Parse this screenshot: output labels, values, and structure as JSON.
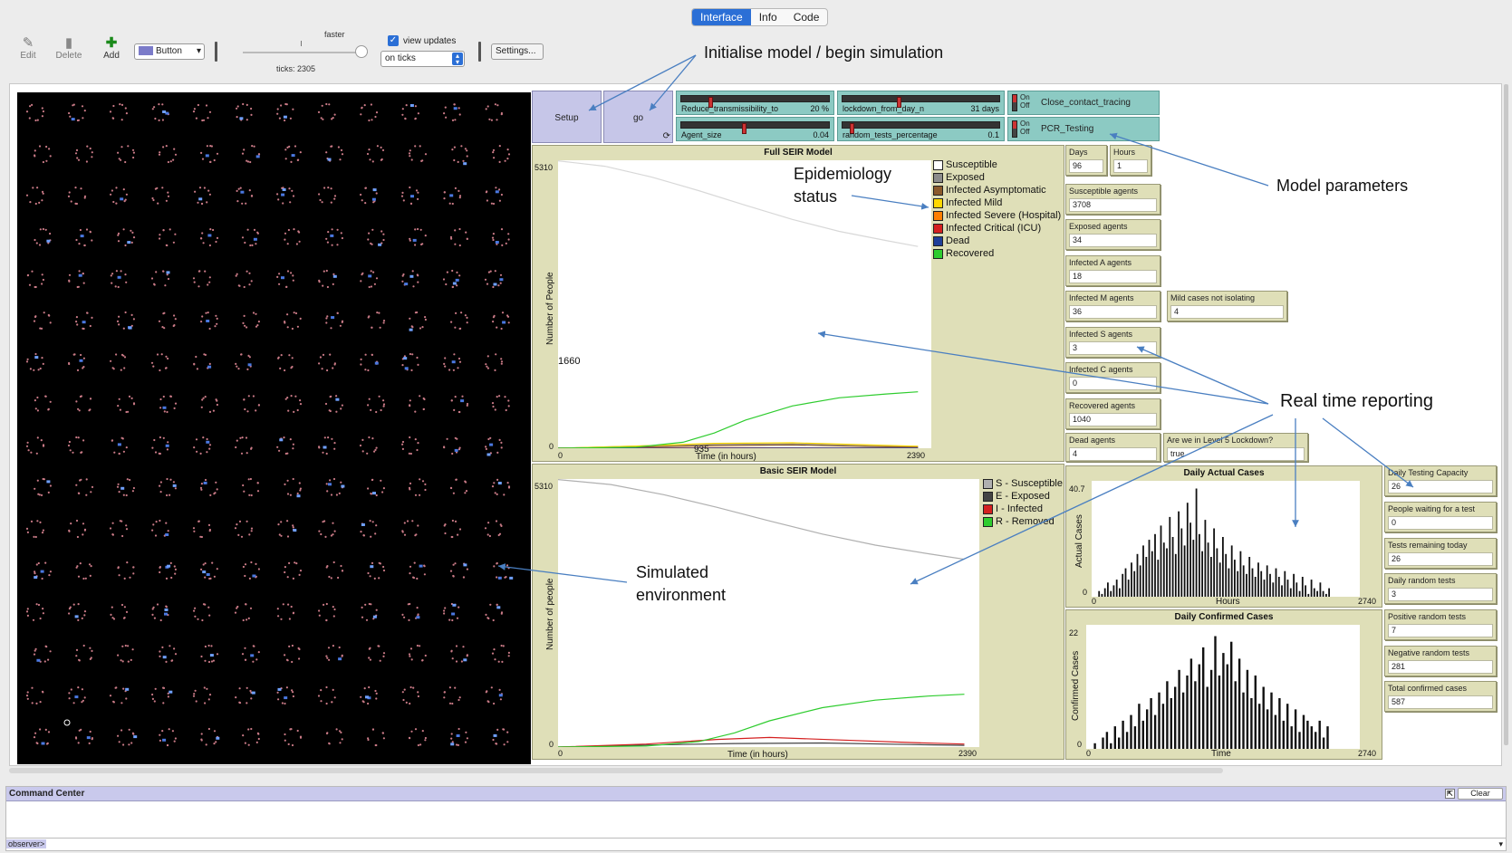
{
  "tabs": [
    {
      "label": "Interface",
      "active": true
    },
    {
      "label": "Info",
      "active": false
    },
    {
      "label": "Code",
      "active": false
    }
  ],
  "toolbar": {
    "edit_label": "Edit",
    "delete_label": "Delete",
    "add_label": "Add",
    "widget_type": "Button",
    "speed_label": "faster",
    "ticks_label": "ticks: 2305",
    "view_updates_label": "view updates",
    "view_updates_checked": true,
    "update_mode": "on ticks",
    "settings_label": "Settings..."
  },
  "buttons": {
    "setup": "Setup",
    "go": "go"
  },
  "sliders": [
    {
      "label": "Reduce_transmissibility_to",
      "value": "20 %",
      "level": 0.18
    },
    {
      "label": "lockdown_from_day_n",
      "value": "31 days",
      "level": 0.35
    },
    {
      "label": "Agent_size",
      "value": "0.04",
      "level": 0.4
    },
    {
      "label": "random_tests_percentage",
      "value": "0.1",
      "level": 0.05
    }
  ],
  "switches": [
    {
      "on": "On",
      "off": "Off",
      "label": "Close_contact_tracing"
    },
    {
      "on": "On",
      "off": "Off",
      "label": "PCR_Testing"
    }
  ],
  "monitors": {
    "days": {
      "label": "Days",
      "value": "96"
    },
    "hours": {
      "label": "Hours",
      "value": "1"
    },
    "susceptible": {
      "label": "Susceptible agents",
      "value": "3708"
    },
    "exposed": {
      "label": "Exposed agents",
      "value": "34"
    },
    "infected_a": {
      "label": "Infected A agents",
      "value": "18"
    },
    "infected_m": {
      "label": "Infected M agents",
      "value": "36"
    },
    "mild_not_isolating": {
      "label": "Mild cases not isolating",
      "value": "4"
    },
    "infected_s": {
      "label": "Infected S agents",
      "value": "3"
    },
    "infected_c": {
      "label": "Infected C agents",
      "value": "0"
    },
    "recovered": {
      "label": "Recovered agents",
      "value": "1040"
    },
    "dead": {
      "label": "Dead agents",
      "value": "4"
    },
    "lockdown": {
      "label": "Are we in Level 5 Lockdown?",
      "value": "true"
    },
    "daily_testing": {
      "label": "Daily Testing Capacity",
      "value": "26"
    },
    "waiting": {
      "label": "People waiting for a test",
      "value": "0"
    },
    "tests_remaining": {
      "label": "Tests remaining today",
      "value": "26"
    },
    "daily_random": {
      "label": "Daily random tests",
      "value": "3"
    },
    "positive_random": {
      "label": "Positive random tests",
      "value": "7"
    },
    "negative_random": {
      "label": "Negative random tests",
      "value": "281"
    },
    "total_confirmed": {
      "label": "Total confirmed cases",
      "value": "587"
    }
  },
  "chart_data": [
    {
      "type": "line",
      "title": "Full SEIR Model",
      "xlabel": "Time (in hours)",
      "ylabel": "Number of People",
      "xlim": [
        0,
        2390
      ],
      "ylim": [
        0,
        5310
      ],
      "x_ticks": [
        "0",
        "2390"
      ],
      "y_ticks": [
        "0",
        "5310"
      ],
      "annotations": [
        "1660",
        "935"
      ],
      "series": [
        {
          "name": "Susceptible",
          "color": "#ffffff",
          "x": [
            0,
            300,
            600,
            900,
            1200,
            1500,
            1800,
            2100,
            2305
          ],
          "y": [
            5300,
            5200,
            5000,
            4750,
            4480,
            4220,
            4000,
            3830,
            3720
          ]
        },
        {
          "name": "Exposed",
          "color": "#8c8c8c",
          "x": [
            0,
            500,
            1000,
            1500,
            2000,
            2305
          ],
          "y": [
            0,
            40,
            70,
            80,
            50,
            34
          ]
        },
        {
          "name": "Infected Asymptomatic",
          "color": "#8b5a2b",
          "x": [
            0,
            500,
            1000,
            1500,
            2000,
            2305
          ],
          "y": [
            0,
            20,
            50,
            60,
            30,
            18
          ]
        },
        {
          "name": "Infected Mild",
          "color": "#ffd800",
          "x": [
            0,
            500,
            1000,
            1500,
            2000,
            2305
          ],
          "y": [
            0,
            40,
            90,
            100,
            60,
            36
          ]
        },
        {
          "name": "Infected Severe (Hospital)",
          "color": "#ff7f00",
          "x": [
            0,
            1000,
            2305
          ],
          "y": [
            0,
            10,
            3
          ]
        },
        {
          "name": "Infected Critical (ICU)",
          "color": "#d42020",
          "x": [
            0,
            1000,
            2305
          ],
          "y": [
            0,
            4,
            0
          ]
        },
        {
          "name": "Dead",
          "color": "#1f3f99",
          "x": [
            0,
            1000,
            2305
          ],
          "y": [
            0,
            2,
            4
          ]
        },
        {
          "name": "Recovered",
          "color": "#2ecc2e",
          "x": [
            0,
            500,
            800,
            1000,
            1200,
            1500,
            1800,
            2100,
            2305
          ],
          "y": [
            0,
            20,
            110,
            280,
            520,
            780,
            930,
            1000,
            1040
          ]
        }
      ],
      "legend": "right"
    },
    {
      "type": "line",
      "title": "Basic SEIR Model",
      "xlabel": "Time (in hours)",
      "ylabel": "Number of people",
      "xlim": [
        0,
        2390
      ],
      "ylim": [
        0,
        5310
      ],
      "x_ticks": [
        "0",
        "2390"
      ],
      "y_ticks": [
        "0",
        "5310"
      ],
      "series": [
        {
          "name": "S - Susceptible",
          "color": "#b0b0b0",
          "x": [
            0,
            300,
            600,
            900,
            1200,
            1500,
            1800,
            2100,
            2305
          ],
          "y": [
            5300,
            5200,
            5000,
            4750,
            4480,
            4220,
            4000,
            3830,
            3720
          ]
        },
        {
          "name": "E - Exposed",
          "color": "#444444",
          "x": [
            0,
            500,
            1000,
            1500,
            2000,
            2305
          ],
          "y": [
            0,
            40,
            70,
            80,
            50,
            34
          ]
        },
        {
          "name": "I - Infected",
          "color": "#d42020",
          "x": [
            0,
            500,
            900,
            1200,
            1600,
            2000,
            2305
          ],
          "y": [
            0,
            60,
            150,
            190,
            140,
            90,
            60
          ]
        },
        {
          "name": "R - Removed",
          "color": "#2ecc2e",
          "x": [
            0,
            500,
            800,
            1000,
            1200,
            1500,
            1800,
            2100,
            2305
          ],
          "y": [
            0,
            20,
            110,
            280,
            520,
            780,
            930,
            1010,
            1045
          ]
        }
      ],
      "legend": "right"
    },
    {
      "type": "bar",
      "title": "Daily Actual Cases",
      "xlabel": "Hours",
      "ylabel": "Actual Cases",
      "xlim": [
        0,
        2740
      ],
      "ylim": [
        0,
        40.7
      ],
      "x_ticks": [
        "0",
        "2740"
      ],
      "y_ticks": [
        "0",
        "40.7"
      ],
      "values": [
        0,
        2,
        1,
        3,
        5,
        2,
        4,
        6,
        3,
        8,
        10,
        6,
        12,
        9,
        15,
        11,
        18,
        14,
        20,
        16,
        22,
        13,
        25,
        19,
        17,
        28,
        21,
        15,
        30,
        24,
        18,
        33,
        26,
        20,
        38,
        22,
        16,
        27,
        19,
        14,
        24,
        17,
        12,
        21,
        15,
        10,
        18,
        13,
        9,
        16,
        11,
        8,
        14,
        10,
        7,
        12,
        9,
        6,
        11,
        8,
        5,
        10,
        7,
        4,
        9,
        6,
        3,
        8,
        5,
        2,
        7,
        4,
        1,
        6,
        3,
        2,
        5,
        2,
        1,
        3
      ]
    },
    {
      "type": "bar",
      "title": "Daily Confirmed Cases",
      "xlabel": "Time",
      "ylabel": "Confirmed Cases",
      "xlim": [
        0,
        2740
      ],
      "ylim": [
        0,
        22
      ],
      "x_ticks": [
        "0",
        "2740"
      ],
      "y_ticks": [
        "0",
        "22"
      ],
      "values": [
        0,
        1,
        0,
        2,
        3,
        1,
        4,
        2,
        5,
        3,
        6,
        4,
        8,
        5,
        7,
        9,
        6,
        10,
        8,
        12,
        9,
        11,
        14,
        10,
        13,
        16,
        12,
        15,
        18,
        11,
        14,
        20,
        13,
        17,
        15,
        19,
        12,
        16,
        10,
        14,
        9,
        13,
        8,
        11,
        7,
        10,
        6,
        9,
        5,
        8,
        4,
        7,
        3,
        6,
        5,
        4,
        3,
        5,
        2,
        4
      ]
    }
  ],
  "annotations": {
    "init": "Initialise model / begin simulation",
    "epidemiology_1": "Epidemiology",
    "epidemiology_2": "status",
    "params": "Model parameters",
    "reporting": "Real time reporting",
    "env_1": "Simulated",
    "env_2": "environment"
  },
  "command_center": {
    "title": "Command Center",
    "clear_label": "Clear",
    "prompt": "observer>"
  },
  "colors": {
    "world_bg": "#000000",
    "widget_bg": "#dfdfb8",
    "button_bg": "#c6c6e8",
    "switch_bg": "#8ccac3",
    "tab_active": "#2b6fd6",
    "annotation_arrow": "#4a7fc1"
  }
}
